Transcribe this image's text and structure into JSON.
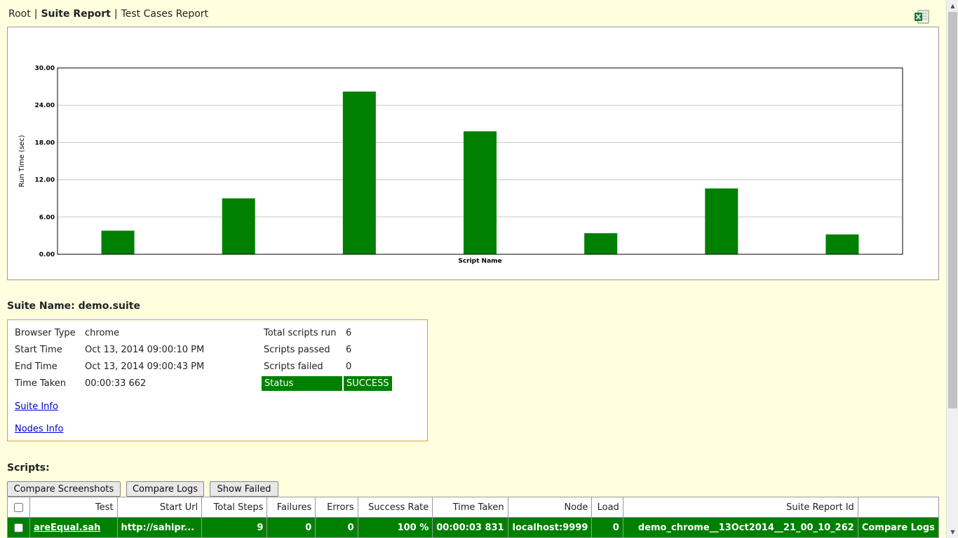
{
  "breadcrumb": {
    "items": [
      {
        "label": "Root",
        "active": false
      },
      {
        "label": "Suite Report",
        "active": true
      },
      {
        "label": "Test Cases Report",
        "active": false
      }
    ],
    "separator": "|"
  },
  "toolbar": {
    "export_icon": "excel-icon"
  },
  "chart_data": {
    "type": "bar",
    "categories": [
      "",
      "",
      "",
      "",
      "",
      "",
      ""
    ],
    "values": [
      3.8,
      9.0,
      26.2,
      19.8,
      3.4,
      10.6,
      3.2
    ],
    "xlabel": "Script Name",
    "ylabel": "Run Time (sec)",
    "ylim": [
      0,
      30
    ],
    "yticks": [
      "0.00",
      "6.00",
      "12.00",
      "18.00",
      "24.00",
      "30.00"
    ],
    "grid": true,
    "bar_color": "#008000"
  },
  "suite": {
    "name_label": "Suite Name: demo.suite",
    "browser_type_label": "Browser Type",
    "browser_type": "chrome",
    "start_time_label": "Start Time",
    "start_time": "Oct 13, 2014 09:00:10 PM",
    "end_time_label": "End Time",
    "end_time": "Oct 13, 2014 09:00:43 PM",
    "time_taken_label": "Time Taken",
    "time_taken": "00:00:33 662",
    "total_scripts_label": "Total scripts run",
    "total_scripts": "6",
    "passed_label": "Scripts passed",
    "passed": "6",
    "failed_label": "Scripts failed",
    "failed": "0",
    "status_label": "Status",
    "status": "SUCCESS",
    "suite_info_link": "Suite Info",
    "nodes_info_link": "Nodes Info"
  },
  "scripts": {
    "heading": "Scripts:",
    "buttons": {
      "compare_screenshots": "Compare Screenshots",
      "compare_logs": "Compare Logs",
      "show_failed": "Show Failed"
    },
    "columns": [
      "Test",
      "Start Url",
      "Total Steps",
      "Failures",
      "Errors",
      "Success Rate",
      "Time Taken",
      "Node",
      "Load",
      "Suite Report Id",
      ""
    ],
    "rows": [
      {
        "test": "areEqual.sah",
        "start_url": "http://sahipr...",
        "total_steps": "9",
        "failures": "0",
        "errors": "0",
        "success_rate": "100 %",
        "time_taken": "00:00:03 831",
        "node": "localhost:9999",
        "load": "0",
        "suite_report_id": "demo_chrome__13Oct2014__21_00_10_262",
        "action": "Compare Logs"
      }
    ]
  },
  "colors": {
    "page_bg": "#ffffe0",
    "success_green": "#008000",
    "info_border": "#d9a520"
  }
}
